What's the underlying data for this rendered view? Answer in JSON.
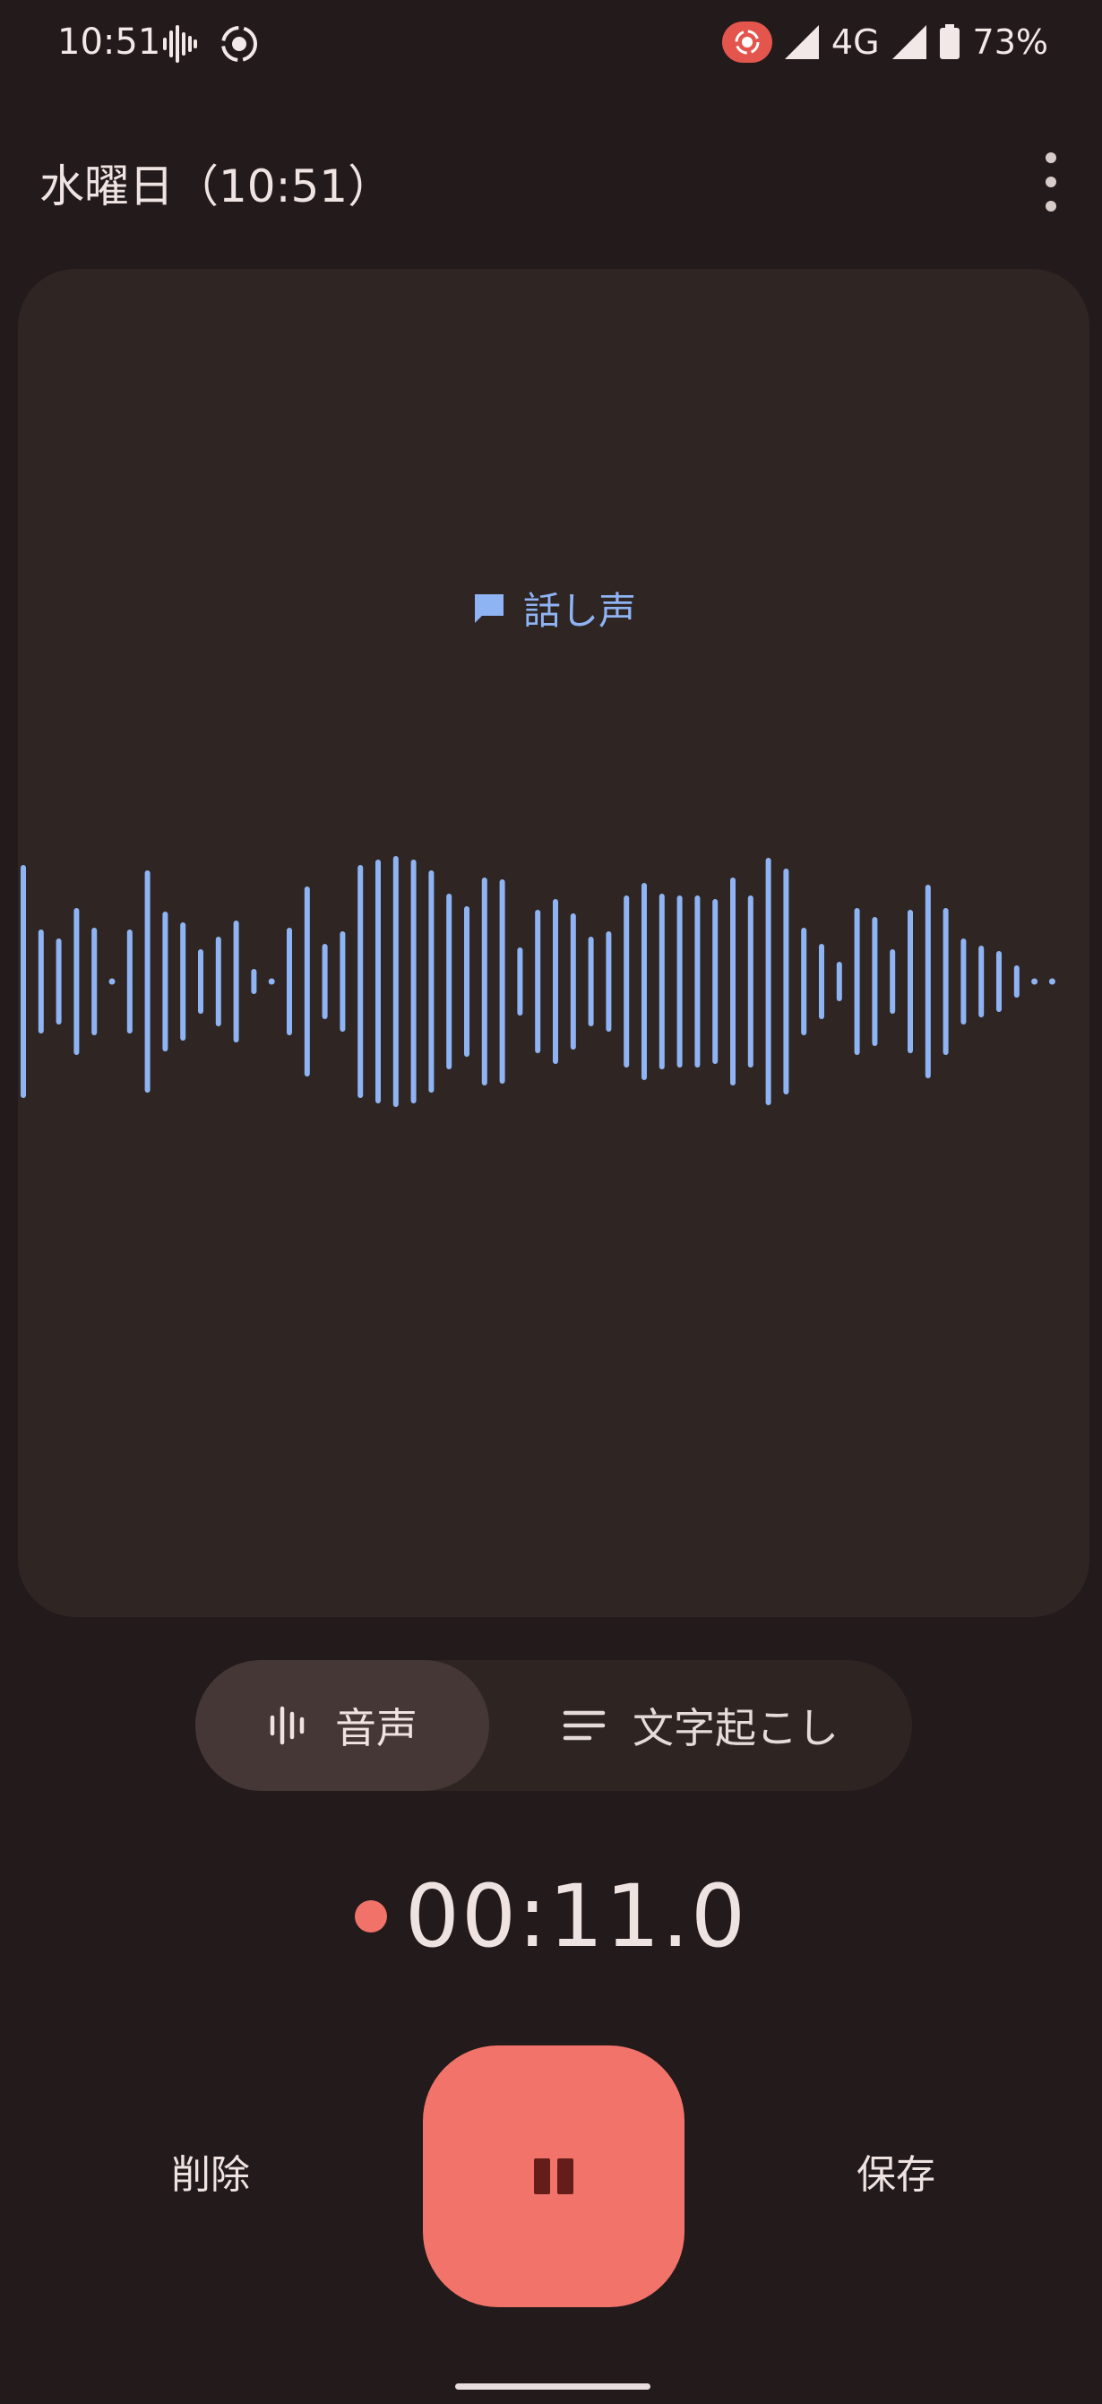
{
  "status_bar": {
    "time": "10:51",
    "network": "4G",
    "battery": "73%",
    "icons": [
      "audio-waveform-icon",
      "screen-record-icon",
      "recording-indicator-icon",
      "signal-icon",
      "battery-icon"
    ]
  },
  "header": {
    "title": "水曜日（10:51）",
    "menu_icon": "more-vert-icon"
  },
  "waveform_card": {
    "label": "話し声",
    "label_icon": "chat-bubble-icon",
    "bars": [
      130,
      58,
      48,
      82,
      60,
      4,
      58,
      124,
      78,
      66,
      36,
      50,
      68,
      14,
      4,
      60,
      106,
      42,
      56,
      130,
      136,
      140,
      136,
      124,
      98,
      84,
      116,
      114,
      38,
      80,
      92,
      76,
      50,
      56,
      96,
      110,
      98,
      96,
      96,
      92,
      116,
      96,
      138,
      126,
      60,
      42,
      22,
      82,
      72,
      36,
      80,
      108,
      82,
      48,
      40,
      34,
      18,
      4,
      4
    ],
    "bar_color": "#8fb4f4"
  },
  "tabs": {
    "audio_label": "音声",
    "audio_icon": "waveform-icon",
    "transcript_label": "文字起こし",
    "transcript_icon": "subject-lines-icon",
    "selected": "audio"
  },
  "recording": {
    "timer": "00:11.0",
    "dot_color": "#f07268"
  },
  "controls": {
    "delete_label": "削除",
    "save_label": "保存",
    "pause_icon": "pause-icon",
    "accent": "#f2736a"
  }
}
